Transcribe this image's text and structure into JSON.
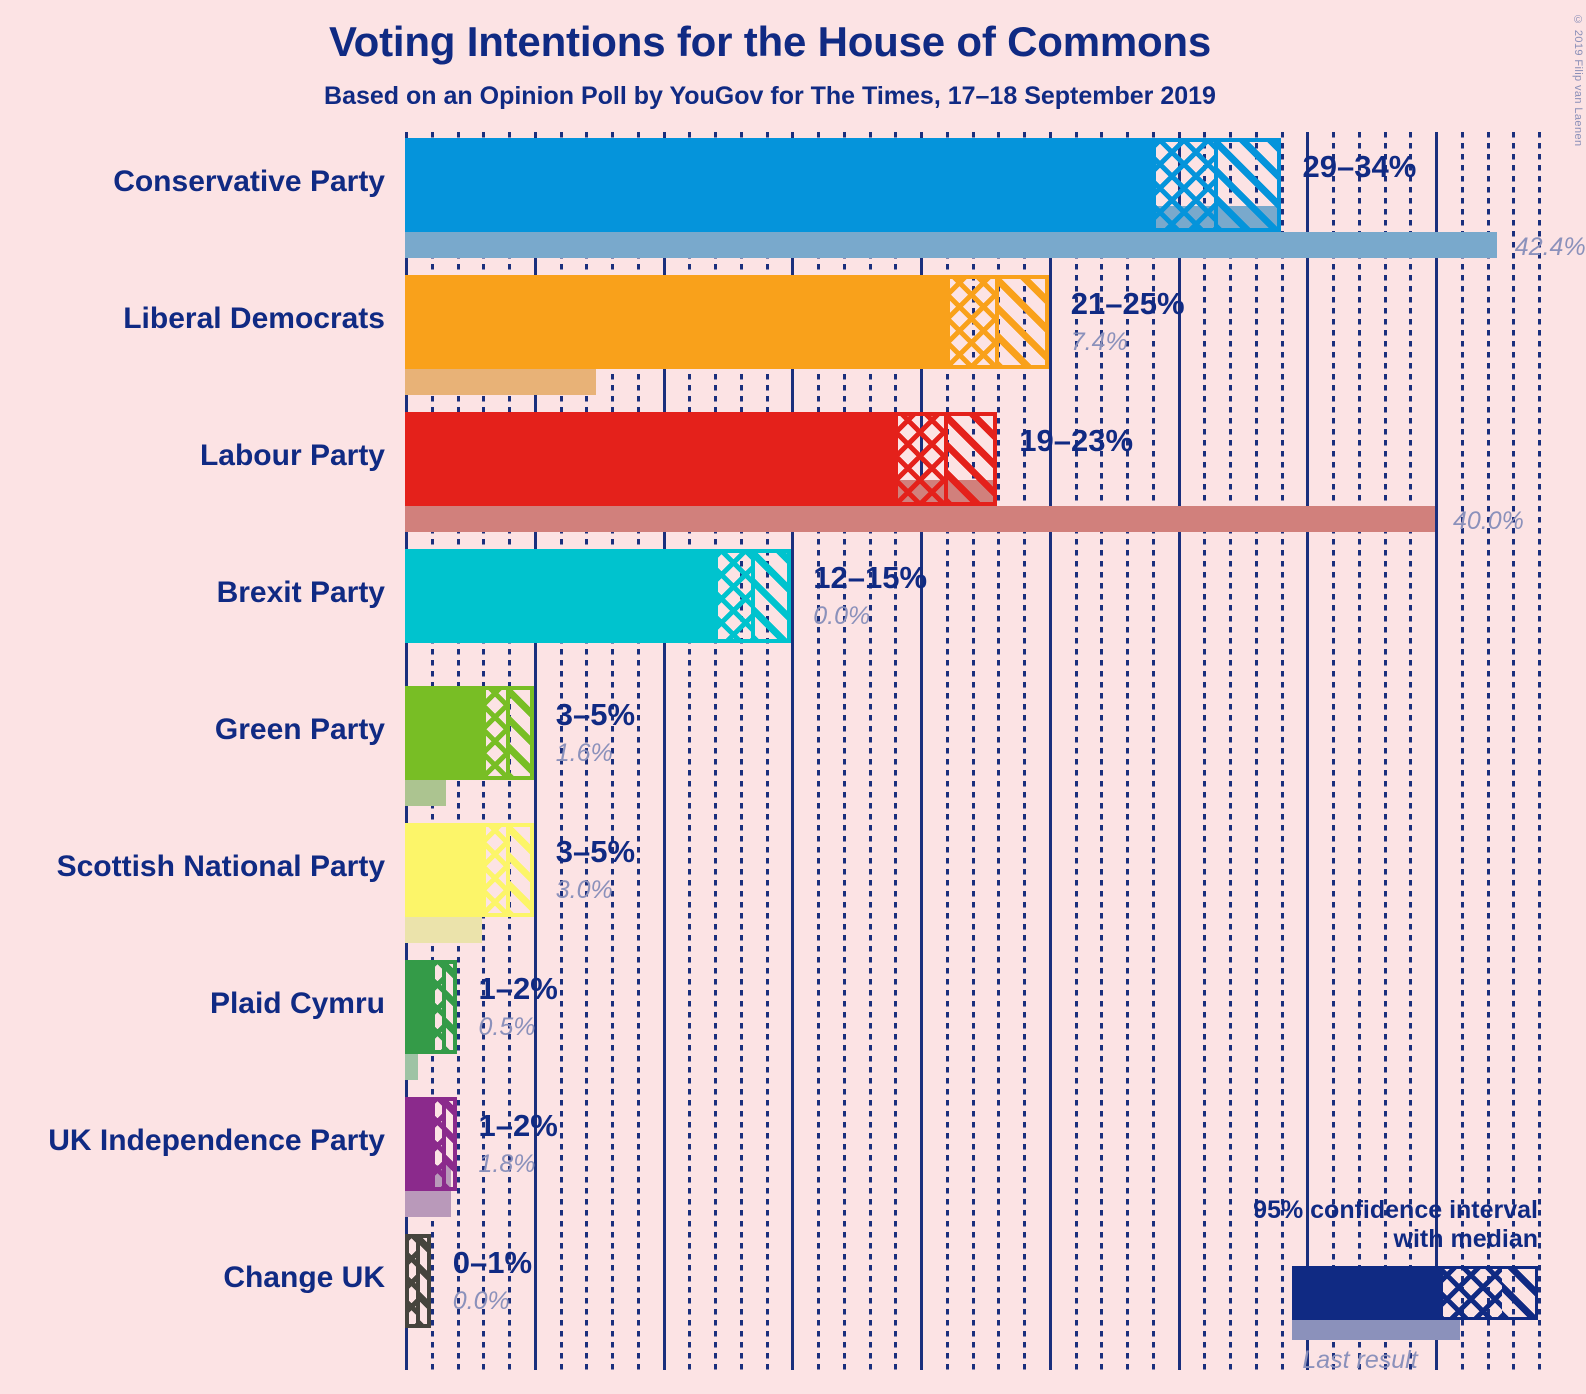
{
  "header": {
    "title": "Voting Intentions for the House of Commons",
    "subtitle": "Based on an Opinion Poll by YouGov for The Times, 17–18 September 2019",
    "copyright": "© 2019 Filip van Laenen"
  },
  "legend": {
    "line1": "95% confidence interval",
    "line2": "with median",
    "last_result_label": "Last result",
    "sample_color": "#102a83",
    "last_result_color": "#8b91bb"
  },
  "colors": {
    "background": "#fce3e4",
    "text": "#102a83",
    "muted_text": "#8b91bb",
    "grid": "#1a2f7d"
  },
  "axis": {
    "origin_pct": 0,
    "max_pct": 44,
    "major_step_pct": 5,
    "minor_step_pct": 1,
    "ticks_shown": false
  },
  "chart_data": {
    "type": "bar",
    "title": "Voting Intentions for the House of Commons",
    "subtitle": "Based on an Opinion Poll by YouGov for The Times, 17–18 September 2019",
    "xlabel": "",
    "ylabel": "",
    "xlim": [
      0,
      44
    ],
    "grid": true,
    "legend_position": "bottom-right",
    "categories": [
      "Conservative Party",
      "Liberal Democrats",
      "Labour Party",
      "Brexit Party",
      "Green Party",
      "Scottish National Party",
      "Plaid Cymru",
      "UK Independence Party",
      "Change UK"
    ],
    "series": [
      {
        "name": "95% confidence interval with median",
        "ci_low": [
          29,
          21,
          19,
          12,
          3,
          3,
          1,
          1,
          0
        ],
        "ci_high": [
          34,
          25,
          23,
          15,
          5,
          5,
          2,
          2,
          1
        ],
        "median": [
          31.5,
          23,
          21,
          13.5,
          4,
          4,
          1.5,
          1.5,
          0.5
        ]
      },
      {
        "name": "Last result",
        "values": [
          42.4,
          7.4,
          40.0,
          0.0,
          1.6,
          3.0,
          0.5,
          1.8,
          0.0
        ]
      }
    ],
    "ci_labels": [
      "29–34%",
      "21–25%",
      "19–23%",
      "12–15%",
      "3–5%",
      "3–5%",
      "1–2%",
      "1–2%",
      "0–1%"
    ],
    "last_result_labels": [
      "42.4%",
      "7.4%",
      "40.0%",
      "0.0%",
      "1.6%",
      "3.0%",
      "0.5%",
      "1.8%",
      "0.0%"
    ]
  },
  "rows": [
    {
      "party": "Conservative Party",
      "color": "#0594db",
      "last_color": "#79a9cc",
      "ci_label": "29–34%",
      "last_label": "42.4%",
      "ci_low": 29,
      "ci_high": 34,
      "median": 31.5,
      "last_result": 42.4
    },
    {
      "party": "Liberal Democrats",
      "color": "#f9a11b",
      "last_color": "#e8b277",
      "ci_label": "21–25%",
      "last_label": "7.4%",
      "ci_low": 21,
      "ci_high": 25,
      "median": 23,
      "last_result": 7.4
    },
    {
      "party": "Labour Party",
      "color": "#e4211b",
      "last_color": "#d1807c",
      "ci_label": "19–23%",
      "last_label": "40.0%",
      "ci_low": 19,
      "ci_high": 23,
      "median": 21,
      "last_result": 40.0
    },
    {
      "party": "Brexit Party",
      "color": "#00c3ce",
      "last_color": "#8fd5da",
      "ci_label": "12–15%",
      "last_label": "0.0%",
      "ci_low": 12,
      "ci_high": 15,
      "median": 13.5,
      "last_result": 0.0
    },
    {
      "party": "Green Party",
      "color": "#78be25",
      "last_color": "#acc490",
      "ci_label": "3–5%",
      "last_label": "1.6%",
      "ci_low": 3,
      "ci_high": 5,
      "median": 4,
      "last_result": 1.6
    },
    {
      "party": "Scottish National Party",
      "color": "#fcf569",
      "last_color": "#ebe3ab",
      "ci_label": "3–5%",
      "last_label": "3.0%",
      "ci_low": 3,
      "ci_high": 5,
      "median": 4,
      "last_result": 3.0
    },
    {
      "party": "Plaid Cymru",
      "color": "#349b48",
      "last_color": "#9ec3a4",
      "ci_label": "1–2%",
      "last_label": "0.5%",
      "ci_low": 1,
      "ci_high": 2,
      "median": 1.5,
      "last_result": 0.5
    },
    {
      "party": "UK Independence Party",
      "color": "#8b2a8c",
      "last_color": "#b999ba",
      "ci_label": "1–2%",
      "last_label": "1.8%",
      "ci_low": 1,
      "ci_high": 2,
      "median": 1.5,
      "last_result": 1.8
    },
    {
      "party": "Change UK",
      "color": "#46443d",
      "last_color": "#a6a49e",
      "ci_label": "0–1%",
      "last_label": "0.0%",
      "ci_low": 0,
      "ci_high": 1,
      "median": 0.5,
      "last_result": 0.0
    }
  ]
}
